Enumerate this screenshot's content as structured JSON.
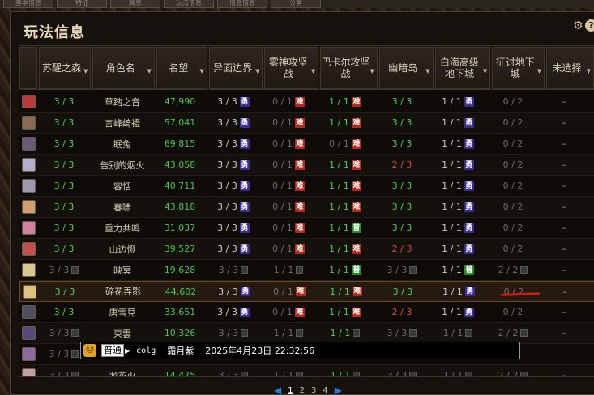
{
  "topbar": {
    "tabs": [
      "基本信息",
      "特征",
      "高息",
      "玩法信息",
      "信息信息",
      "分享"
    ]
  },
  "panel": {
    "title": "玩法信息"
  },
  "columns": [
    {
      "label": "苏醒之森"
    },
    {
      "label": "角色名"
    },
    {
      "label": "名望"
    },
    {
      "label": "异面边界"
    },
    {
      "label": "雾神攻坚战"
    },
    {
      "label": "巴卡尔攻坚战"
    },
    {
      "label": "幽暗岛"
    },
    {
      "label": "白海高级地下城"
    },
    {
      "label": "征讨地下城"
    },
    {
      "label": "未选择"
    }
  ],
  "colors": {
    "green": "#4ed04e",
    "red": "#e14a3a",
    "dim": "#6d6d6d",
    "accent_underline": "#d01a1a"
  },
  "rows": [
    {
      "c0": "3 / 3",
      "name": "草踏之音",
      "fame": "47,990",
      "c3": "3 / 3",
      "c4": "0 / 1",
      "c5": "1 / 1",
      "c6": "3 / 3",
      "c7": "1 / 1",
      "c8": "0 / 2",
      "c9": "–"
    },
    {
      "c0": "3 / 3",
      "name": "言峰绮禮",
      "fame": "57,041",
      "c3": "3 / 3",
      "c4": "0 / 1",
      "c5": "1 / 1",
      "c6": "3 / 3",
      "c7": "1 / 1",
      "c8": "0 / 2",
      "c9": "–"
    },
    {
      "c0": "3 / 3",
      "name": "眠兔",
      "fame": "69,815",
      "c3": "3 / 3",
      "c4": "0 / 1",
      "c5": "0 / 1",
      "c6": "3 / 3",
      "c7": "1 / 1",
      "c8": "0 / 2",
      "c9": "–"
    },
    {
      "c0": "3 / 3",
      "name": "告别的烟火",
      "fame": "43,058",
      "c3": "3 / 3",
      "c4": "0 / 1",
      "c5": "1 / 1",
      "c6": "2 / 3",
      "c7": "1 / 1",
      "c8": "0 / 2",
      "c9": "–"
    },
    {
      "c0": "3 / 3",
      "name": "容恬",
      "fame": "40,711",
      "c3": "3 / 3",
      "c4": "0 / 1",
      "c5": "1 / 1",
      "c6": "3 / 3",
      "c7": "1 / 1",
      "c8": "0 / 2",
      "c9": "–"
    },
    {
      "c0": "3 / 3",
      "name": "春啸",
      "fame": "43,818",
      "c3": "3 / 3",
      "c4": "0 / 1",
      "c5": "1 / 1",
      "c6": "3 / 3",
      "c7": "1 / 1",
      "c8": "0 / 2",
      "c9": "–"
    },
    {
      "c0": "3 / 3",
      "name": "重力共鸣",
      "fame": "31,037",
      "c3": "3 / 3",
      "c4": "0 / 1",
      "c5": "1 / 1",
      "c6": "3 / 3",
      "c7": "1 / 1",
      "c8": "0 / 2",
      "c9": "–"
    },
    {
      "c0": "3 / 3",
      "name": "山边憕",
      "fame": "39,527",
      "c3": "3 / 3",
      "c4": "0 / 1",
      "c5": "1 / 1",
      "c6": "2 / 3",
      "c7": "1 / 1",
      "c8": "0 / 2",
      "c9": "–"
    },
    {
      "c0": "3 / 3",
      "name": "映冥",
      "fame": "19,628",
      "c3": "3 / 3",
      "c4": "1 / 1",
      "c5": "1 / 1",
      "c6": "3 / 3",
      "c7": "1 / 1",
      "c8": "2 / 2",
      "c9": "–"
    },
    {
      "c0": "3 / 3",
      "name": "碎花弄影",
      "fame": "44,602",
      "c3": "3 / 3",
      "c4": "0 / 1",
      "c5": "1 / 1",
      "c6": "3 / 3",
      "c7": "1 / 1",
      "c8": "0 / 2",
      "c9": "–"
    },
    {
      "c0": "3 / 3",
      "name": "唐雪見",
      "fame": "33,651",
      "c3": "3 / 3",
      "c4": "0 / 1",
      "c5": "1 / 1",
      "c6": "2 / 3",
      "c7": "1 / 1",
      "c8": "0 / 2",
      "c9": "–"
    },
    {
      "c0": "3 / 3",
      "name": "東雲",
      "fame": "10,326",
      "c3": "3 / 3",
      "c4": "1 / 1",
      "c5": "1 / 1",
      "c6": "3 / 3",
      "c7": "1 / 1",
      "c8": "2 / 2",
      "c9": "–"
    },
    {
      "c0": "3 / 3",
      "name": "",
      "fame": "",
      "c3": "",
      "c4": "",
      "c5": "",
      "c6": "",
      "c7": "",
      "c8": "",
      "c9": ""
    },
    {
      "c0": "3 / 3",
      "name": "龙花火",
      "fame": "14,475",
      "c3": "3 / 3",
      "c4": "1 / 1",
      "c5": "1 / 1",
      "c6": "3 / 3",
      "c7": "1 / 1",
      "c8": "2 / 2",
      "c9": "–"
    }
  ],
  "tags": {
    "brave": "勇",
    "hard": "难",
    "normal": "普"
  },
  "chat": {
    "mode": "普通",
    "channel": "colg",
    "sender": "霜月紫",
    "timestamp": "2025年4月23日 22:32:56"
  },
  "pager": {
    "pages": [
      "1",
      "2",
      "3",
      "4"
    ],
    "current": "1"
  }
}
